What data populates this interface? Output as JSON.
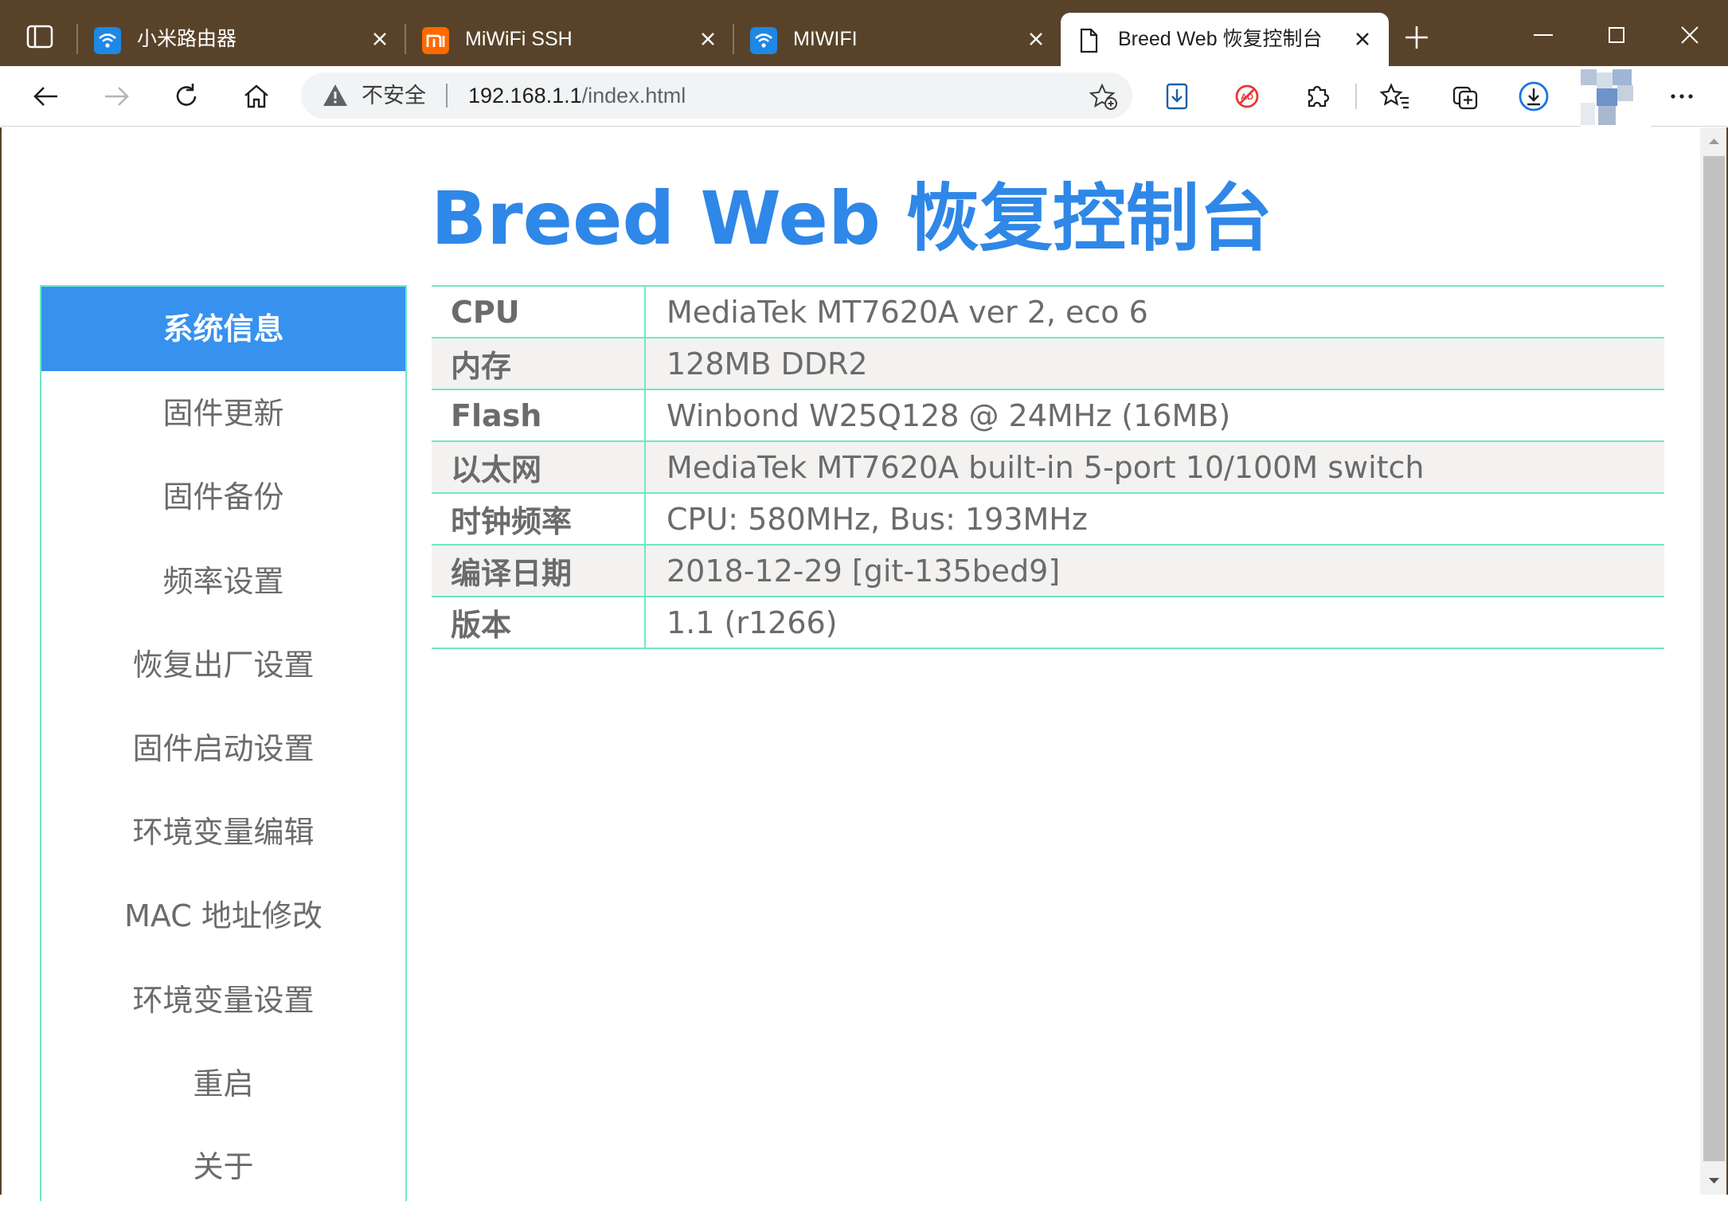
{
  "browser": {
    "tabs": [
      {
        "label": "小米路由器",
        "icon": "wifi-icon"
      },
      {
        "label": "MiWiFi SSH",
        "icon": "mi-logo-icon"
      },
      {
        "label": "MIWIFI",
        "icon": "wifi-icon"
      },
      {
        "label": "Breed Web 恢复控制台",
        "icon": "page-icon"
      }
    ],
    "address": {
      "security_label": "不安全",
      "host": "192.168.1.1",
      "path": "/index.html"
    }
  },
  "page": {
    "title": "Breed Web 恢复控制台",
    "sidebar": [
      {
        "label": "系统信息"
      },
      {
        "label": "固件更新"
      },
      {
        "label": "固件备份"
      },
      {
        "label": "频率设置"
      },
      {
        "label": "恢复出厂设置"
      },
      {
        "label": "固件启动设置"
      },
      {
        "label": "环境变量编辑"
      },
      {
        "label": "MAC 地址修改"
      },
      {
        "label": "环境变量设置"
      },
      {
        "label": "重启"
      },
      {
        "label": "关于"
      }
    ],
    "info": [
      {
        "key": "CPU",
        "value": "MediaTek MT7620A ver 2, eco 6"
      },
      {
        "key": "内存",
        "value": "128MB DDR2"
      },
      {
        "key": "Flash",
        "value": "Winbond W25Q128 @ 24MHz (16MB)"
      },
      {
        "key": "以太网",
        "value": "MediaTek MT7620A built-in 5-port 10/100M switch"
      },
      {
        "key": "时钟频率",
        "value": "CPU: 580MHz, Bus: 193MHz"
      },
      {
        "key": "编译日期",
        "value": "2018-12-29 [git-135bed9]"
      },
      {
        "key": "版本",
        "value": "1.1 (r1266)"
      }
    ]
  },
  "colors": {
    "titlebar": "#58432a",
    "accent": "#2f87e7",
    "sidebar_active": "#3791ef",
    "table_border": "#6ee8c4"
  }
}
